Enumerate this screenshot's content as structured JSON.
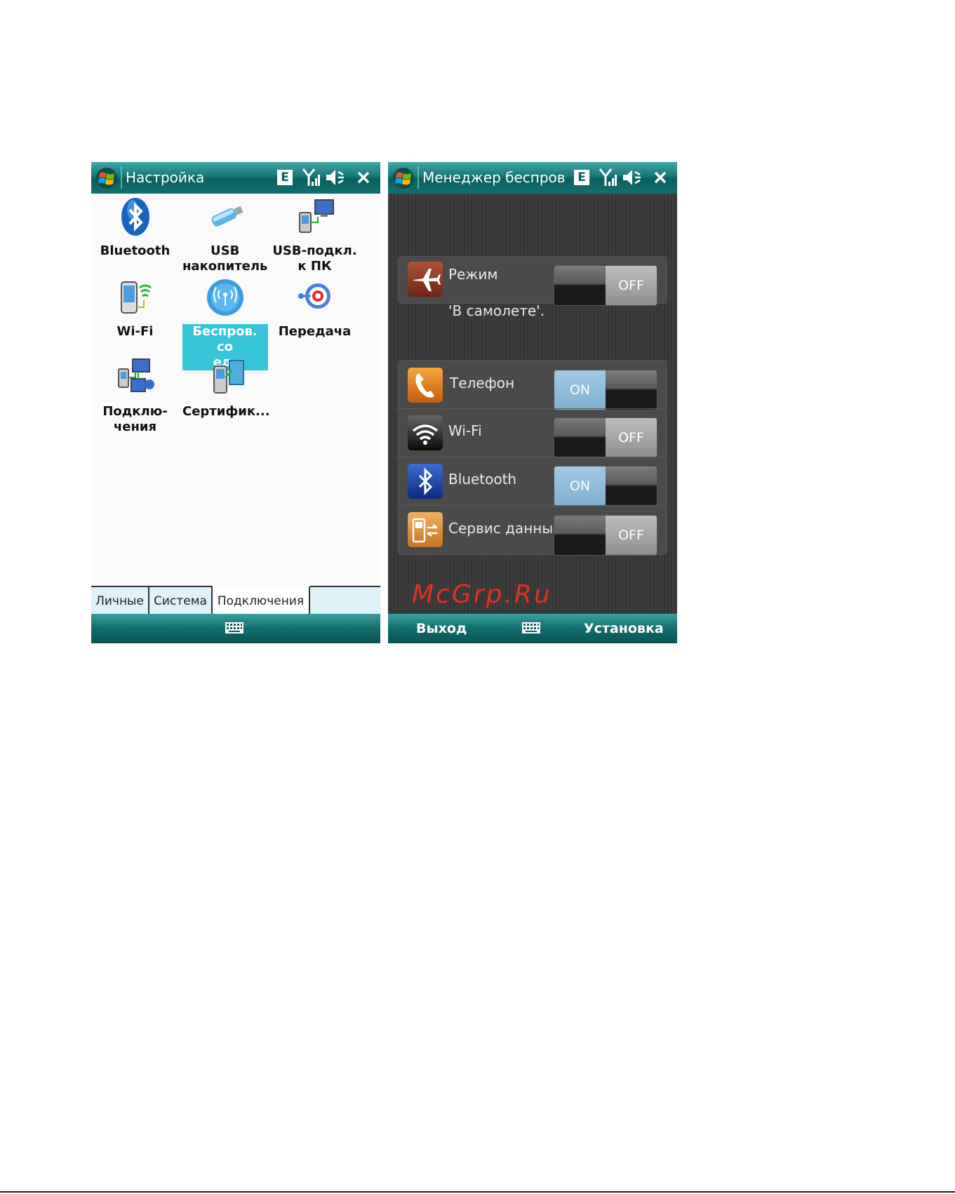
{
  "left_screen": {
    "title": "Настройка",
    "status_e": "E",
    "items": [
      {
        "label": "Bluetooth",
        "icon": "bluetooth-icon"
      },
      {
        "label": "USB\nнакопитель",
        "icon": "usb-drive-icon"
      },
      {
        "label": "USB-подкл.\nк ПК",
        "icon": "usb-pc-connection-icon"
      },
      {
        "label": "Wi-Fi",
        "icon": "wifi-device-icon"
      },
      {
        "label": "Беспров. со\nед.",
        "icon": "wireless-connections-icon"
      },
      {
        "label": "Передача",
        "icon": "beam-icon"
      },
      {
        "label": "Подклю-\nчения",
        "icon": "connections-icon"
      },
      {
        "label": "Сертифик...",
        "icon": "certificates-icon"
      }
    ],
    "tabs": [
      "Личные",
      "Система",
      "Подключения"
    ],
    "active_tab": "Подключения"
  },
  "right_screen": {
    "title": "Менеджер беспров",
    "status_e": "E",
    "airplane": {
      "label_line1": "Режим",
      "label_line2": "'В самолете'.",
      "state": "OFF"
    },
    "rows": [
      {
        "label": "Телефон",
        "state": "ON",
        "icon": "phone-icon"
      },
      {
        "label": "Wi-Fi",
        "state": "OFF",
        "icon": "wifi-icon"
      },
      {
        "label": "Bluetooth",
        "state": "ON",
        "icon": "bluetooth-icon"
      },
      {
        "label": "Сервис данных",
        "state": "OFF",
        "icon": "data-service-icon"
      }
    ],
    "softkey_left": "Выход",
    "softkey_right": "Установка",
    "watermark": "McGrp.Ru"
  },
  "colors": {
    "titlebar": "#157575",
    "selected": "#36c5d8",
    "toggle_on": "#8fbcdc"
  }
}
